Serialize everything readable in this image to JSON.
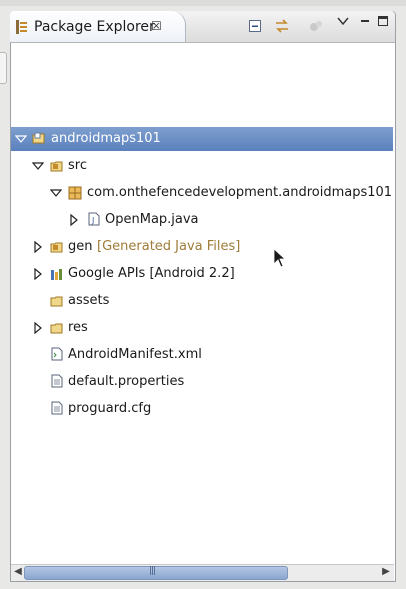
{
  "view": {
    "title": "Package Explorer",
    "close_glyph": "☒",
    "title_icon": "package-explorer-icon",
    "toolbar": [
      {
        "name": "collapse-all-button",
        "icon": "collapse-all-icon"
      },
      {
        "name": "link-with-editor-button",
        "icon": "link-with-editor-icon"
      },
      {
        "name": "filter-button",
        "icon": "filter-icon"
      },
      {
        "name": "view-menu-button",
        "icon": "chevron-down-icon"
      },
      {
        "name": "minimize-button",
        "icon": "minimize-icon"
      },
      {
        "name": "maximize-button",
        "icon": "maximize-icon"
      }
    ]
  },
  "tree": {
    "project": "androidmaps101",
    "src": "src",
    "package": "com.onthefencedevelopment.androidmaps101",
    "file_openmap": "OpenMap.java",
    "gen": "gen",
    "gen_decoration": "[Generated Java Files]",
    "google_apis": "Google APIs [Android 2.2]",
    "assets": "assets",
    "res": "res",
    "manifest": "AndroidManifest.xml",
    "default_props": "default.properties",
    "proguard": "proguard.cfg"
  },
  "scrollbar": {
    "thumb_grip": "|||"
  },
  "colors": {
    "selection": "#5b81bd",
    "folder": "#e7c15a",
    "package": "#c58a2b",
    "decoration": "#9e7b38"
  }
}
